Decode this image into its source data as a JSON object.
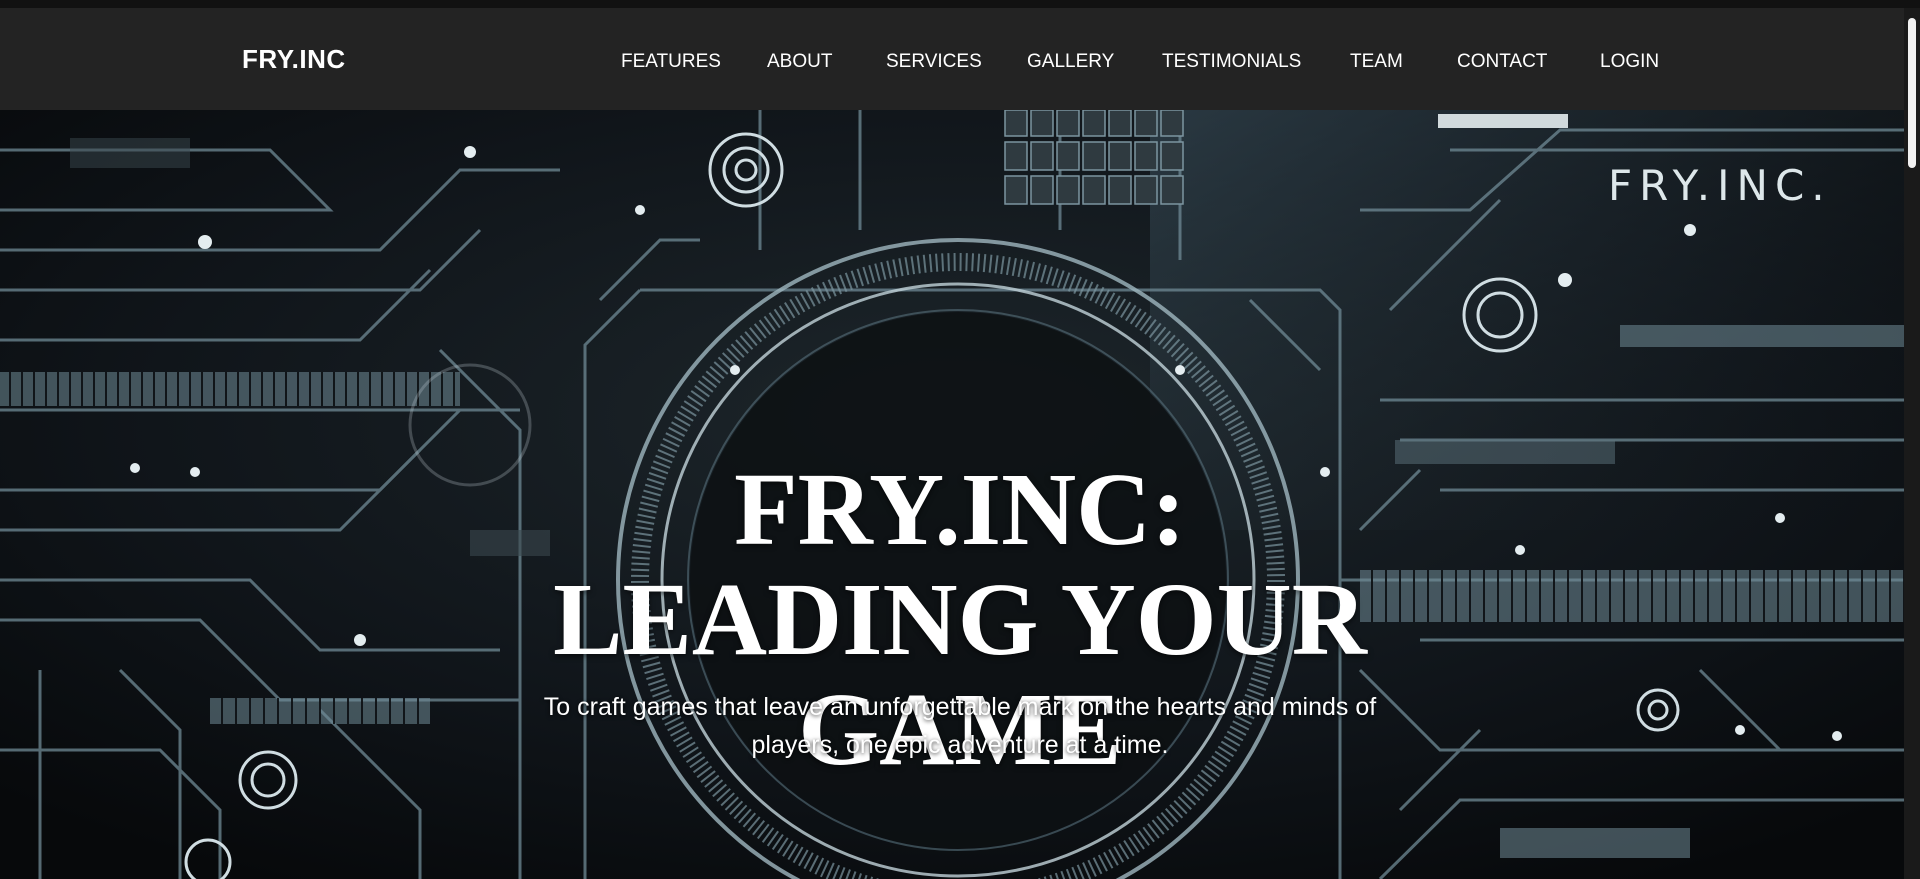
{
  "brand": {
    "name": "FRY.INC"
  },
  "nav": {
    "links": [
      "FEATURES",
      "ABOUT",
      "SERVICES",
      "GALLERY",
      "TESTIMONIALS",
      "TEAM",
      "CONTACT",
      "LOGIN"
    ]
  },
  "hero": {
    "title_lines": [
      "FRY.INC:",
      "LEADING YOUR",
      "GAME"
    ],
    "subtitle": "To craft games that leave an unforgettable mark on the hearts and minds of players, one epic adventure at a time.",
    "watermark": "FRY.INC."
  },
  "colors": {
    "navbar": "#232323",
    "text": "#ffffff",
    "hero_bg": "#0c0f12",
    "circuit": "#6f8a95"
  }
}
